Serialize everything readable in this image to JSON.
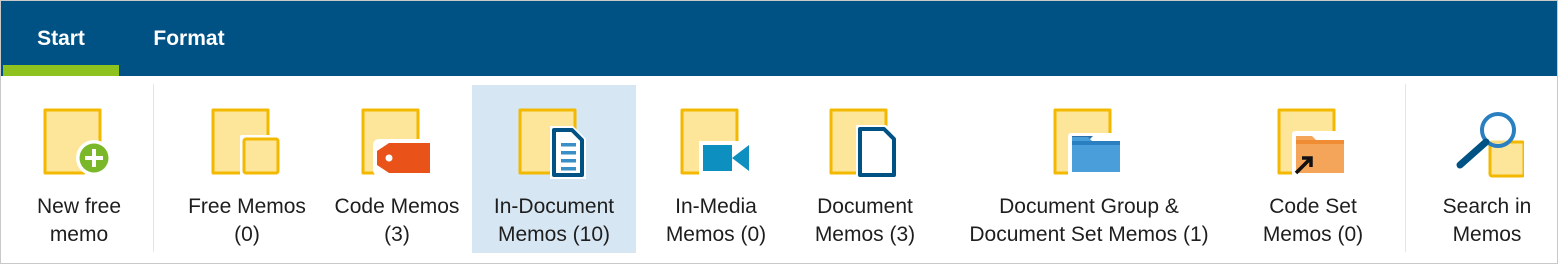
{
  "tabs": [
    {
      "label": "Start",
      "active": true
    },
    {
      "label": "Format",
      "active": false
    }
  ],
  "colors": {
    "tabbar": "#005285",
    "active_tab_underline": "#8dc21f",
    "selected_button": "#d6e6f3",
    "memo_yellow": "#fde59a",
    "memo_border": "#f3b800"
  },
  "buttons": [
    {
      "line1": "New free",
      "line2": "memo",
      "icon": "new-memo-icon"
    },
    {
      "line1": "Free Memos",
      "line2": "(0)",
      "icon": "free-memos-icon"
    },
    {
      "line1": "Code Memos",
      "line2": "(3)",
      "icon": "code-memos-icon"
    },
    {
      "line1": "In-Document",
      "line2": "Memos (10)",
      "icon": "in-document-memos-icon",
      "selected": true
    },
    {
      "line1": "In-Media",
      "line2": "Memos (0)",
      "icon": "in-media-memos-icon"
    },
    {
      "line1": "Document",
      "line2": "Memos (3)",
      "icon": "document-memos-icon"
    },
    {
      "line1": "Document Group &",
      "line2": "Document Set Memos (1)",
      "icon": "document-group-memos-icon"
    },
    {
      "line1": "Code Set",
      "line2": "Memos (0)",
      "icon": "code-set-memos-icon"
    },
    {
      "line1": "Search in",
      "line2": "Memos",
      "icon": "search-memos-icon"
    }
  ]
}
